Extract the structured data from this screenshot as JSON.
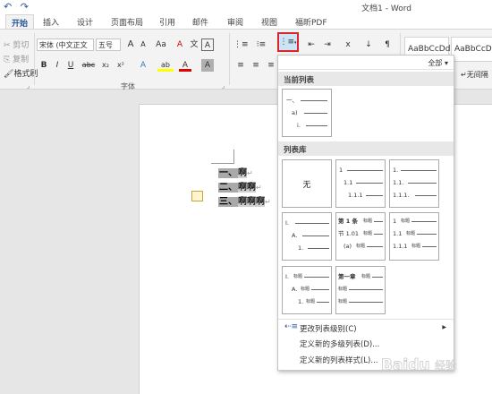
{
  "window": {
    "title": "文档1 - Word",
    "quick_access": {
      "undo": "↶",
      "redo": "↷"
    }
  },
  "tabs": [
    {
      "label": "开始"
    },
    {
      "label": "插入"
    },
    {
      "label": "设计"
    },
    {
      "label": "页面布局"
    },
    {
      "label": "引用"
    },
    {
      "label": "邮件"
    },
    {
      "label": "审阅"
    },
    {
      "label": "视图"
    },
    {
      "label": "福昕PDF"
    }
  ],
  "clipboard": {
    "cut": "剪切",
    "copy": "复制",
    "format_painter": "格式刷"
  },
  "font": {
    "name": "宋体 (中文正文",
    "size": "五号",
    "grow": "A",
    "shrink": "A",
    "case": "Aa",
    "clear": "A",
    "phonetic": "文",
    "border": "A",
    "bold": "B",
    "italic": "I",
    "underline": "U",
    "strike": "abc",
    "subscript": "x₂",
    "superscript": "x²",
    "effects": "A",
    "highlight": "ab",
    "color": "A",
    "shade": "A",
    "char_border": "A",
    "group_label": "字体"
  },
  "styles": {
    "style1": "AaBbCcDd",
    "style2": "AaBbCcDd",
    "no_spacing": "无间隔"
  },
  "list_menu": {
    "filter": "全部 ▾",
    "current_header": "当前列表",
    "library_header": "列表库",
    "current_preview": {
      "l1": "一、",
      "l2": "a)",
      "l3": "i."
    },
    "none_label": "无",
    "tile2": {
      "l1": "1",
      "l2": "1.1",
      "l3": "1.1.1"
    },
    "tile3": {
      "l1": "1.",
      "l2": "1.1.",
      "l3": "1.1.1."
    },
    "tile4": {
      "l1": "I.",
      "l2": "A.",
      "l3": "1."
    },
    "tile5": {
      "l1": "第 1 条",
      "l1b": "标题",
      "l2": "节 1.01",
      "l2b": "标题",
      "l3": "(a)",
      "l3b": "标题"
    },
    "tile6": {
      "l1": "1",
      "l1b": "标题",
      "l2": "1.1",
      "l2b": "标题",
      "l3": "1.1.1",
      "l3b": "标题"
    },
    "tile7": {
      "l1": "I.",
      "l1b": "标题",
      "l2": "A.",
      "l2b": "标题",
      "l3": "1.",
      "l3b": "标题"
    },
    "tile8": {
      "l1": "第一章",
      "l1b": "标题",
      "l2": "标题",
      "l3": "标题"
    },
    "cmd_change_level": "更改列表级别(C)",
    "cmd_define_multilevel": "定义新的多级列表(D)...",
    "cmd_define_style": "定义新的列表样式(L)..."
  },
  "document": {
    "lines": [
      {
        "num": "一、",
        "text": "啊"
      },
      {
        "num": "二、",
        "text": "啊啊"
      },
      {
        "num": "三、",
        "text": "啊啊啊"
      }
    ],
    "para_mark": "↵"
  },
  "colors": {
    "accent": "#2b579a",
    "highlight_box": "#d9252b",
    "ribbon_bg": "#f3f3f3"
  }
}
